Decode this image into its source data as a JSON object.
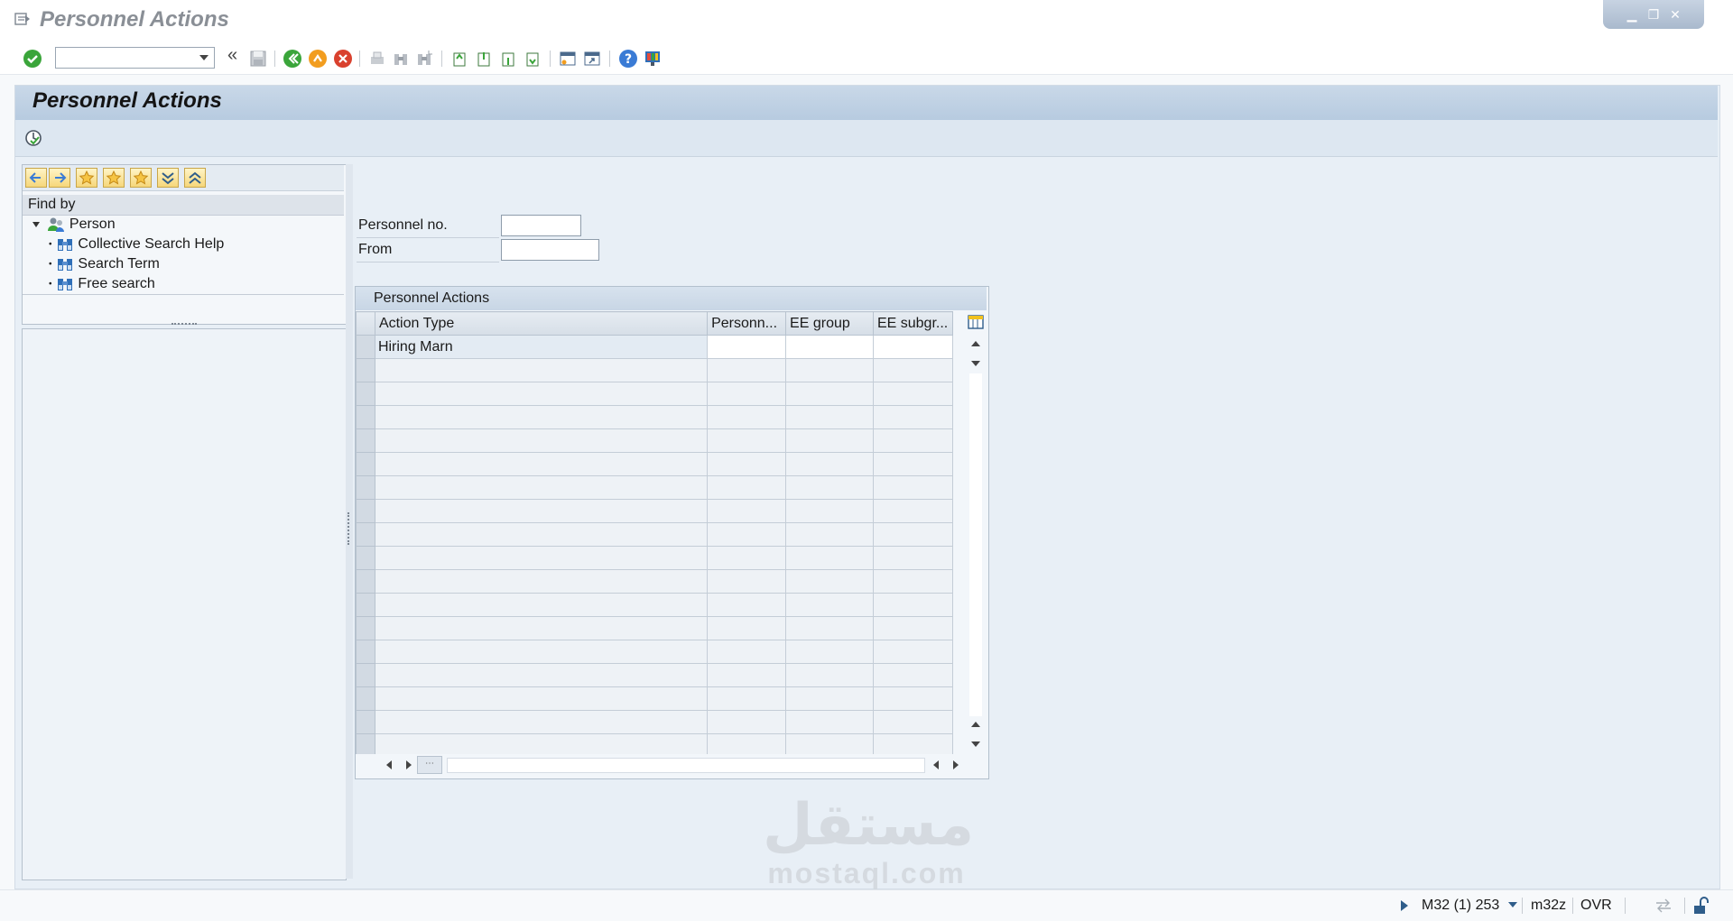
{
  "window": {
    "title": "Personnel Actions",
    "controls": [
      "minimize-icon",
      "restore-icon",
      "close-icon"
    ]
  },
  "toolbar": {
    "command_field_value": "",
    "collapse_glyph": "«",
    "icons": [
      "enter-icon",
      "save-icon",
      "back-icon",
      "exit-icon",
      "cancel-icon",
      "print-icon",
      "find-icon",
      "find-next-icon",
      "first-page-icon",
      "previous-page-icon",
      "next-page-icon",
      "last-page-icon",
      "create-session-icon",
      "shortcut-icon",
      "help-icon",
      "customize-layout-icon"
    ]
  },
  "page": {
    "title": "Personnel Actions",
    "app_icon": "execute-icon"
  },
  "nav": {
    "tool_icons": [
      "arrow-left-icon",
      "arrow-right-icon",
      "favorite-add-icon",
      "favorite-icon",
      "favorite-edit-icon",
      "expand-all-icon",
      "collapse-all-icon"
    ],
    "find_by_label": "Find by",
    "root": {
      "label": "Person",
      "icon": "person-icon"
    },
    "items": [
      {
        "label": "Collective Search Help",
        "icon": "binoculars-icon"
      },
      {
        "label": "Search Term",
        "icon": "binoculars-icon"
      },
      {
        "label": "Free search",
        "icon": "binoculars-icon"
      }
    ]
  },
  "form": {
    "personnel_no_label": "Personnel no.",
    "personnel_no_value": "",
    "from_label": "From",
    "from_value": ""
  },
  "table": {
    "title": "Personnel Actions",
    "columns": [
      "Action Type",
      "Personn...",
      "EE group",
      "EE subgr..."
    ],
    "rows": [
      [
        "Hiring Marn",
        "",
        "",
        ""
      ]
    ],
    "empty_rows": 17
  },
  "status": {
    "system": "M32 (1) 253",
    "client": "m32z",
    "mode": "OVR"
  },
  "watermark": {
    "arabic": "مستقل",
    "latin": "mostaql.com"
  },
  "colors": {
    "accent_green": "#3aa53a",
    "accent_orange": "#f29d1f",
    "accent_red": "#d9412e",
    "header_band": "#c2d3e6"
  }
}
